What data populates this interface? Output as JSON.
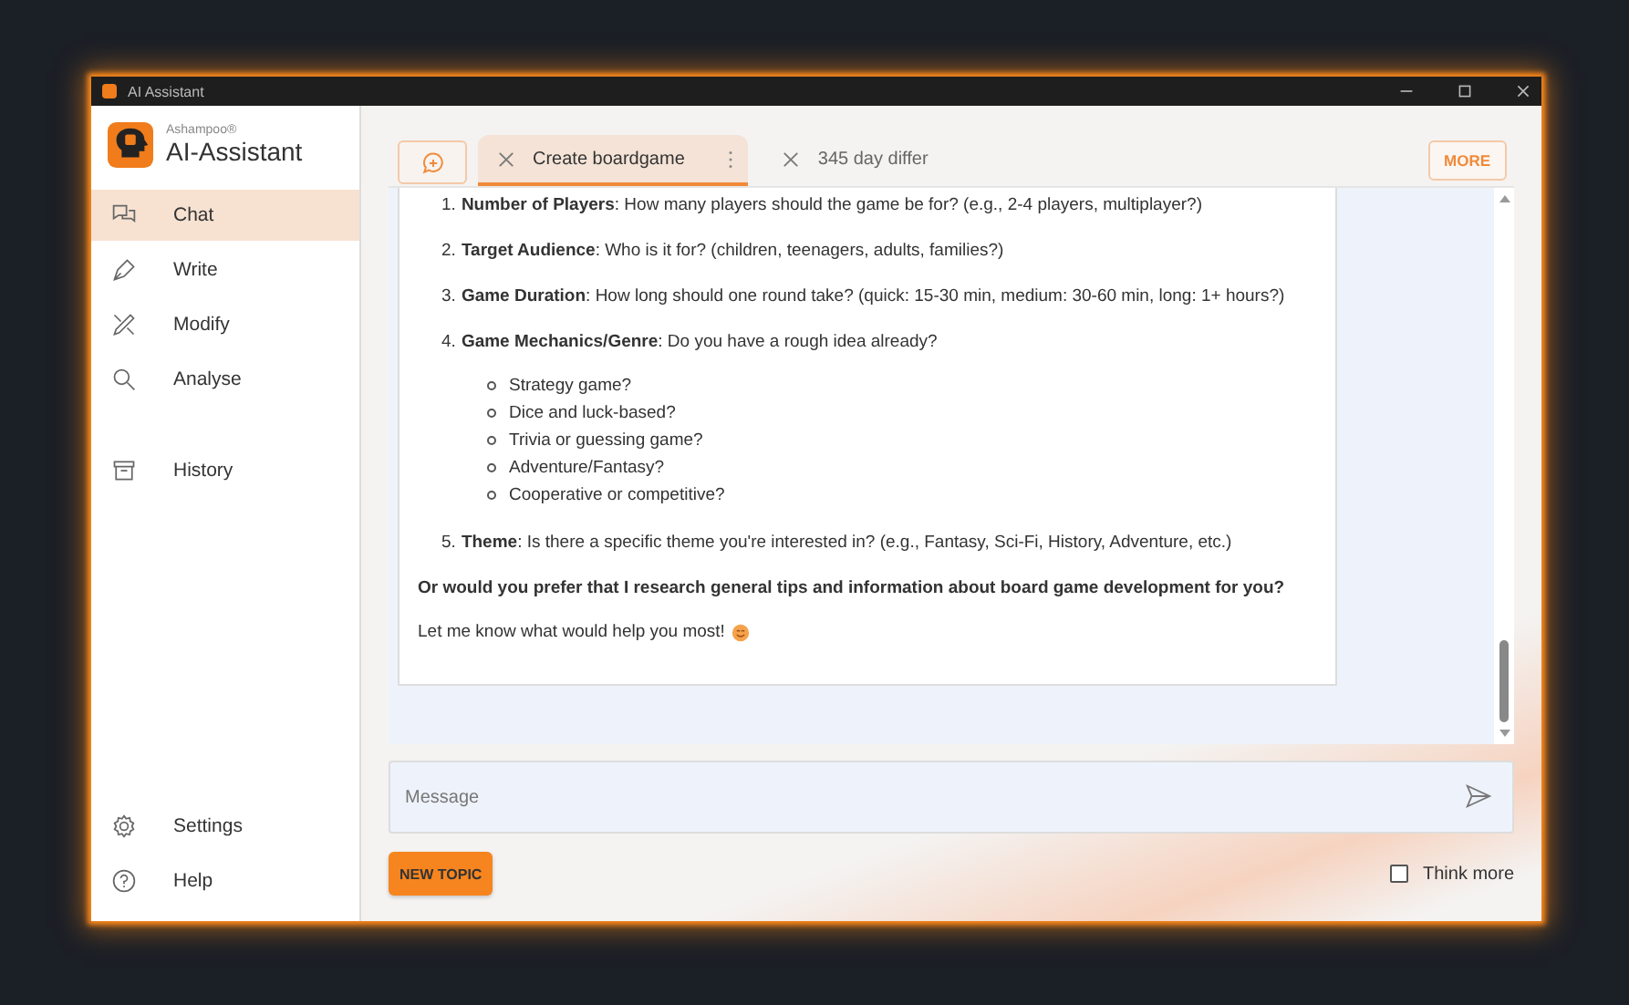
{
  "window": {
    "title": "AI Assistant"
  },
  "brand": {
    "vendor": "Ashampoo®",
    "name": "AI-Assistant"
  },
  "sidebar": {
    "items": [
      {
        "label": "Chat",
        "kind": "chat",
        "selected": true
      },
      {
        "label": "Write",
        "kind": "write",
        "selected": false
      },
      {
        "label": "Modify",
        "kind": "modify",
        "selected": false
      },
      {
        "label": "Analyse",
        "kind": "analyse",
        "selected": false
      },
      {
        "label": "History",
        "kind": "history",
        "selected": false
      }
    ],
    "bottom_items": [
      {
        "label": "Settings",
        "kind": "settings"
      },
      {
        "label": "Help",
        "kind": "help"
      }
    ]
  },
  "tabs": [
    {
      "label": "Create boardgame",
      "selected": true
    },
    {
      "label": "345 day differ",
      "selected": false
    }
  ],
  "more_button": "MORE",
  "message": {
    "numbered": [
      {
        "number": "1.",
        "text": "**Number of Players**: How many players should the game be for? (e.g., 2-4 players, multiplayer?)"
      },
      {
        "number": "2.",
        "text": "**Target Audience**: Who is it for? (children, teenagers, adults, families?)"
      },
      {
        "number": "3.",
        "text": "**Game Duration**: How long should one round take? (quick: 15-30 min, medium: 30-60 min, long: 1+ hours?)"
      },
      {
        "number": "4.",
        "text": "**Game Mechanics/Genre**: Do you have a rough idea already?",
        "bullets": [
          "Strategy game?",
          "Dice and luck-based?",
          "Trivia or guessing game?",
          "Adventure/Fantasy?",
          "Cooperative or competitive?"
        ]
      },
      {
        "number": "5.",
        "text": "**Theme**: Is there a specific theme you're interested in? (e.g., Fantasy, Sci-Fi, History, Adventure, etc.)"
      }
    ],
    "question": "Or would you prefer that I research general tips and information about board game development for you?",
    "closing": "Let me know what would help you most!"
  },
  "input": {
    "placeholder": "Message"
  },
  "new_topic_button": "NEW TOPIC",
  "think_more": {
    "label": "Think more",
    "checked": false
  }
}
